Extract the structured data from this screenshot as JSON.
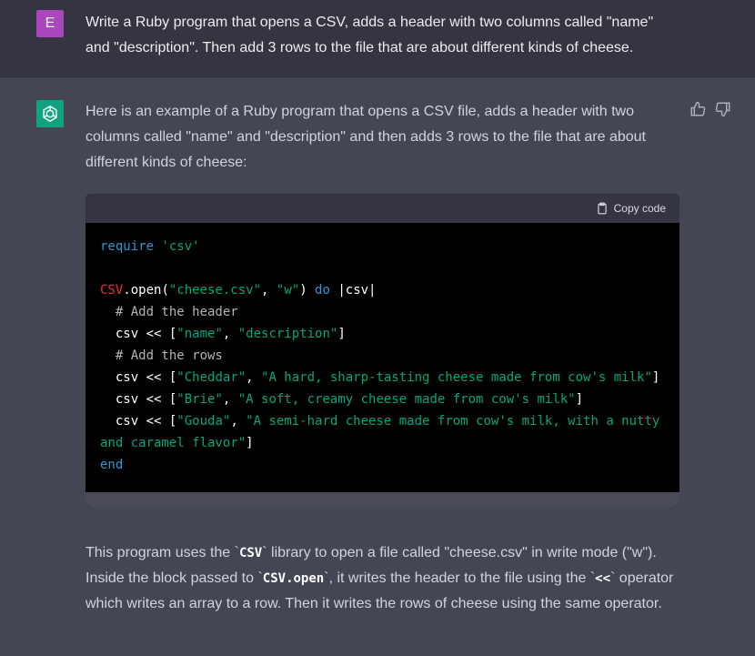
{
  "user": {
    "avatar_letter": "E",
    "message_line1": "Write a Ruby program that opens a CSV, adds a header with two columns called \"name\"",
    "message_line2": "and \"description\".  Then add 3 rows to the file that are about different kinds of cheese."
  },
  "assistant": {
    "avatar_icon": "openai-logo-icon",
    "intro": "Here is an example of a Ruby program that opens a CSV file, adds a header with two columns called \"name\" and \"description\" and then adds 3 rows to the file that are about different kinds of cheese:",
    "copy_label": "Copy code",
    "code": {
      "l1_kw": "require",
      "l1_str": "'csv'",
      "l3_cls": "CSV",
      "l3_a": ".open(",
      "l3_s1": "\"cheese.csv\"",
      "l3_b": ", ",
      "l3_s2": "\"w\"",
      "l3_c": ") ",
      "l3_kw": "do",
      "l3_d": " |csv|",
      "l4": "  # Add the header",
      "l5_a": "  csv << [",
      "l5_s1": "\"name\"",
      "l5_b": ", ",
      "l5_s2": "\"description\"",
      "l5_c": "]",
      "l6": "  # Add the rows",
      "l7_a": "  csv << [",
      "l7_s1": "\"Cheddar\"",
      "l7_b": ", ",
      "l7_s2": "\"A hard, sharp-tasting cheese made from cow's milk\"",
      "l7_c": "]",
      "l8_a": "  csv << [",
      "l8_s1": "\"Brie\"",
      "l8_b": ", ",
      "l8_s2": "\"A soft, creamy cheese made from cow's milk\"",
      "l8_c": "]",
      "l9_a": "  csv << [",
      "l9_s1": "\"Gouda\"",
      "l9_b": ", ",
      "l9_s2": "\"A semi-hard cheese made from cow's milk, with a nutty",
      "l10_s": "and caramel flavor\"",
      "l10_c": "]",
      "l11_kw": "end"
    },
    "outro": {
      "t1": "This program uses the `",
      "c1": "CSV",
      "t2": "` library to open a file called \"cheese.csv\" in write mode (\"w\"). Inside the block passed to `",
      "c2": "CSV.open",
      "t3": "`, it writes the header to the file using the `",
      "c3": "<<",
      "t4": "` operator which writes an array to a row. Then it writes the rows of cheese using the same operator."
    },
    "actions": {
      "thumbs_up": "thumbs-up-icon",
      "thumbs_down": "thumbs-down-icon"
    }
  },
  "colors": {
    "user_bg": "#343541",
    "assistant_bg": "#444654",
    "user_avatar": "#ab47bc",
    "bot_avatar": "#10a37f",
    "keyword": "#2e95d3",
    "string": "#00a67d",
    "class": "#f22c3d"
  }
}
